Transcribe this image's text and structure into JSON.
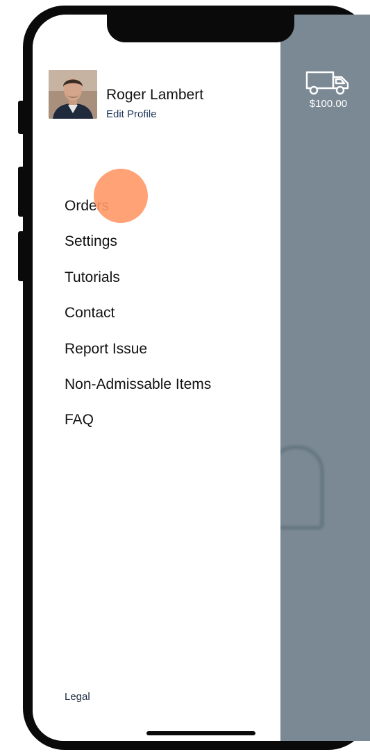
{
  "profile": {
    "name": "Roger Lambert",
    "edit_label": "Edit Profile"
  },
  "menu": {
    "items": [
      {
        "label": "Orders"
      },
      {
        "label": "Settings"
      },
      {
        "label": "Tutorials"
      },
      {
        "label": "Contact"
      },
      {
        "label": "Report Issue"
      },
      {
        "label": "Non-Admissable Items"
      },
      {
        "label": "FAQ"
      }
    ]
  },
  "footer": {
    "legal_label": "Legal"
  },
  "cart": {
    "icon": "truck-icon",
    "amount": "$100.00"
  },
  "colors": {
    "backdrop": "#7b8994",
    "link": "#1c3557",
    "touch_indicator": "#ff9866"
  }
}
